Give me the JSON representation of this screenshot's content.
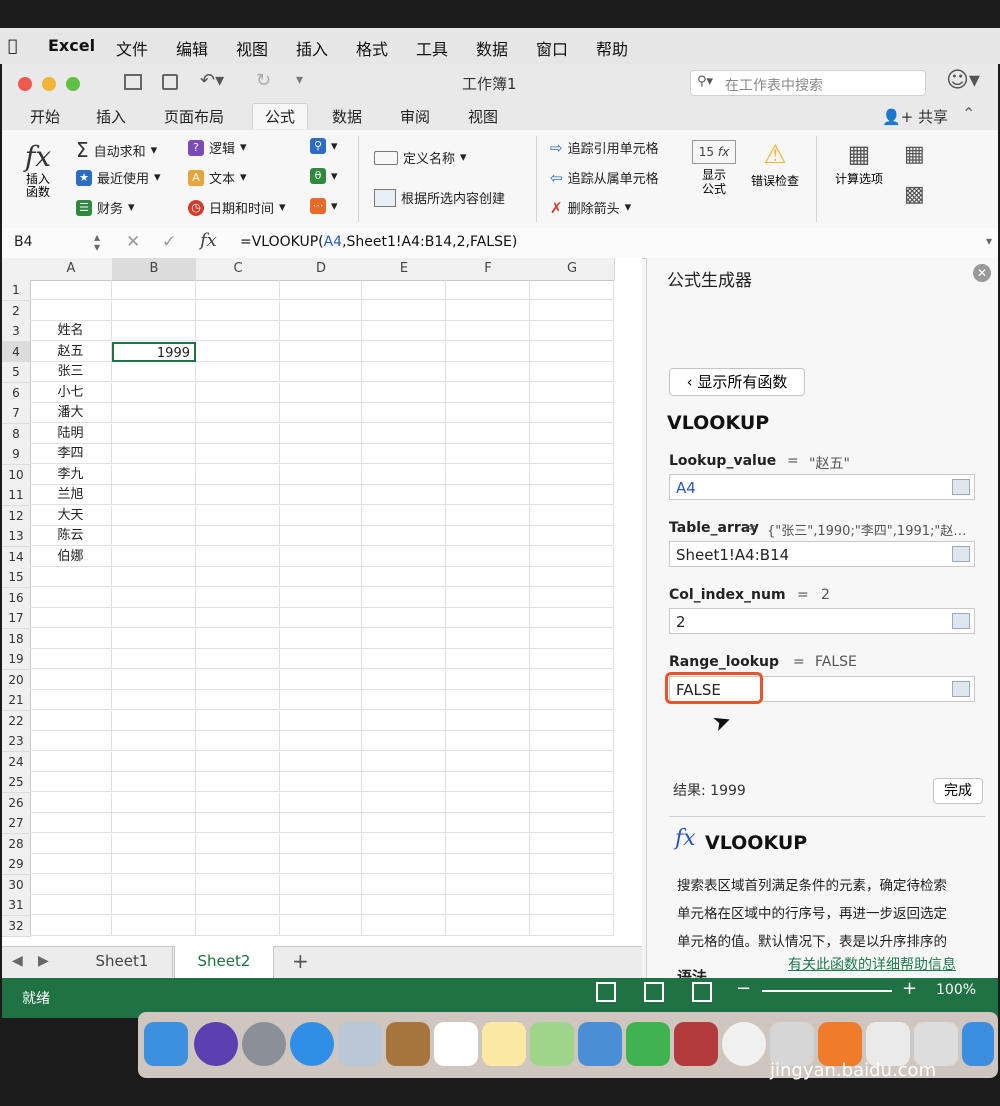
{
  "menubar": {
    "app": "Excel",
    "items": [
      "文件",
      "编辑",
      "视图",
      "插入",
      "格式",
      "工具",
      "数据",
      "窗口",
      "帮助"
    ]
  },
  "window": {
    "title": "工作簿1",
    "search_placeholder": "在工作表中搜索",
    "share": "共享"
  },
  "tabs": [
    "开始",
    "插入",
    "页面布局",
    "公式",
    "数据",
    "审阅",
    "视图"
  ],
  "ribbon": {
    "insert_function": "插入\n函数",
    "autosum": "自动求和",
    "recent": "最近使用",
    "financial": "财务",
    "logical": "逻辑",
    "text": "文本",
    "datetime": "日期和时间",
    "define_name": "定义名称",
    "create_from_selection": "根据所选内容创建",
    "trace_precedents": "追踪引用单元格",
    "trace_dependents": "追踪从属单元格",
    "remove_arrows": "删除箭头",
    "show_formulas": "显示\n公式",
    "error_checking": "错误检查",
    "calc_options": "计算选项"
  },
  "formula_bar": {
    "name_box": "B4",
    "formula_prefix": "=VLOOKUP(",
    "formula_ref": "A4",
    "formula_rest": ",Sheet1!A4:B14,2,FALSE)"
  },
  "grid": {
    "columns": [
      "A",
      "B",
      "C",
      "D",
      "E",
      "F",
      "G"
    ],
    "rows": [
      "1",
      "2",
      "3",
      "4",
      "5",
      "6",
      "7",
      "8",
      "9",
      "10",
      "11",
      "12",
      "13",
      "14",
      "15",
      "16",
      "17",
      "18",
      "19",
      "20",
      "21",
      "22",
      "23",
      "24",
      "25",
      "26",
      "27",
      "28",
      "29",
      "30",
      "31",
      "32"
    ],
    "colA": [
      "",
      "",
      "姓名",
      "赵五",
      "张三",
      "小七",
      "潘大",
      "陆明",
      "李四",
      "李九",
      "兰旭",
      "大天",
      "陈云",
      "伯娜"
    ],
    "b4": "1999"
  },
  "sheet_tabs": [
    "Sheet1",
    "Sheet2"
  ],
  "panel": {
    "title": "公式生成器",
    "show_all": "显示所有函数",
    "func": "VLOOKUP",
    "args": [
      {
        "name": "Lookup_value",
        "eq": "=",
        "preview": "\"赵五\"",
        "input": "A4"
      },
      {
        "name": "Table_array",
        "eq": "=",
        "preview": "{\"张三\",1990;\"李四\",1991;\"赵…",
        "input": "Sheet1!A4:B14"
      },
      {
        "name": "Col_index_num",
        "eq": "=",
        "preview": "2",
        "input": "2"
      },
      {
        "name": "Range_lookup",
        "eq": "=",
        "preview": "FALSE",
        "input": "FALSE"
      }
    ],
    "result": "结果: 1999",
    "done": "完成",
    "fx_title": "VLOOKUP",
    "desc_lines": [
      "搜索表区域首列满足条件的元素，确定待检索",
      "单元格在区域中的行序号，再进一步返回选定",
      "单元格的值。默认情况下，表是以升序排序的"
    ],
    "syntax": "语法",
    "help_link": "有关此函数的详细帮助信息"
  },
  "status": {
    "ready": "就绪",
    "zoom": "100%"
  },
  "watermark": "jingyan.baidu.com",
  "colors": {
    "excel_green": "#1f7244",
    "highlight": "#e8542a",
    "link": "#1f7a4f"
  }
}
